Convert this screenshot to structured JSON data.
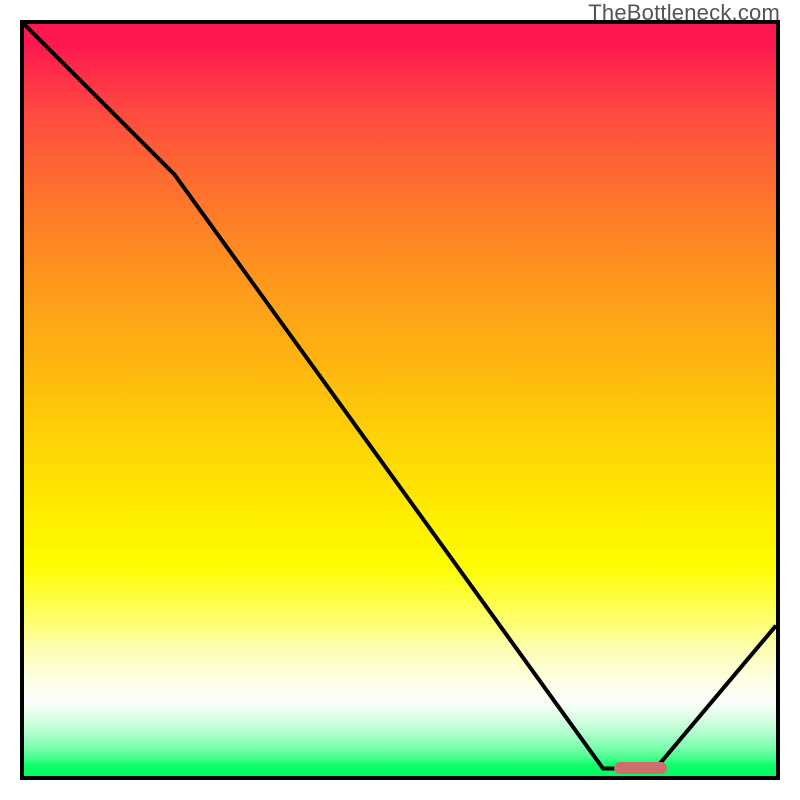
{
  "attribution": "TheBottleneck.com",
  "colors": {
    "curve": "#000000",
    "marker": "#cc6f6e",
    "border": "#000000"
  },
  "chart_data": {
    "type": "line",
    "title": "",
    "xlabel": "",
    "ylabel": "",
    "xlim": [
      0,
      100
    ],
    "ylim": [
      0,
      100
    ],
    "series": [
      {
        "name": "curve",
        "x": [
          0,
          20,
          77,
          84,
          100
        ],
        "values": [
          100,
          80,
          1,
          1,
          20
        ]
      }
    ],
    "marker": {
      "x_start": 78.5,
      "x_end": 85.5,
      "y": 1
    }
  }
}
